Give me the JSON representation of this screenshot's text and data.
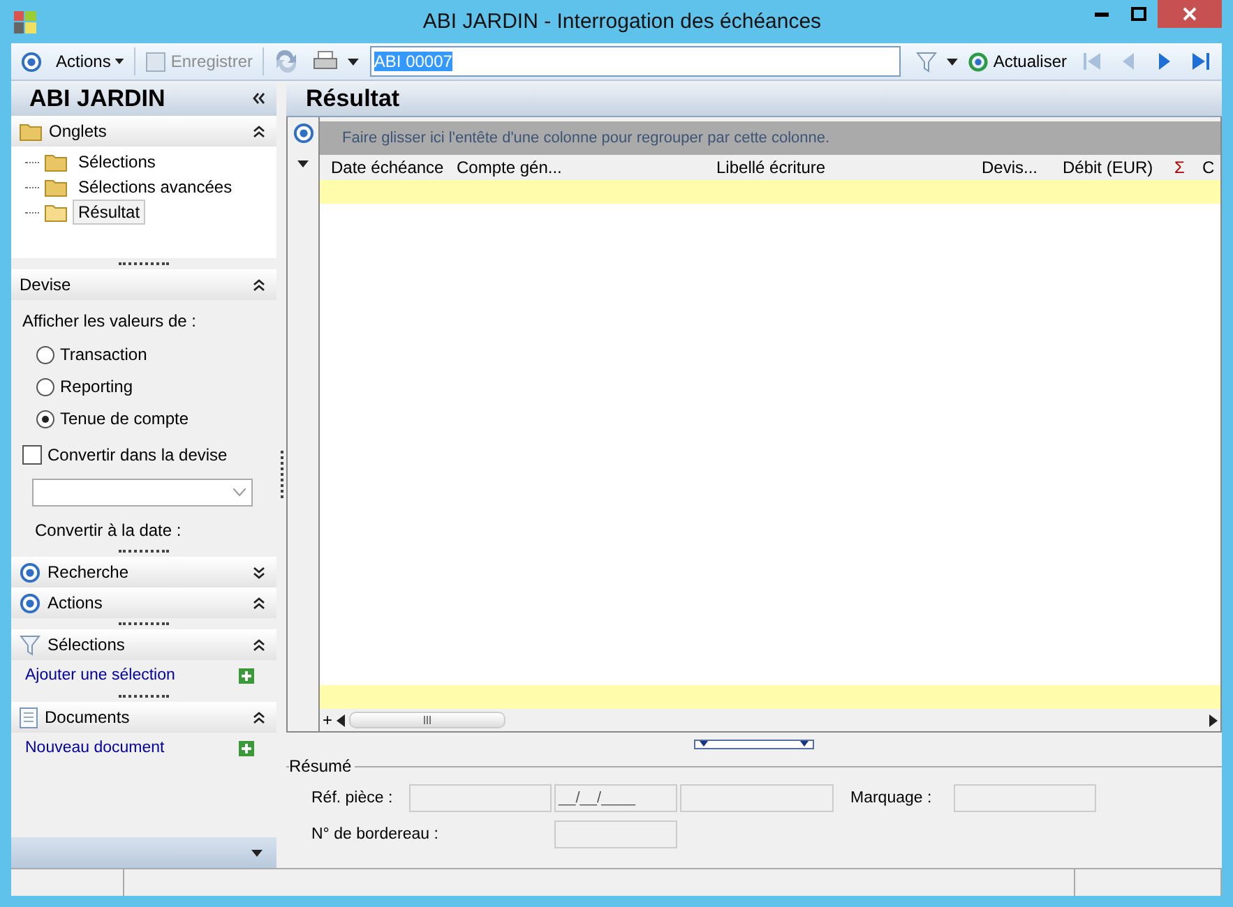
{
  "window": {
    "title": "ABI JARDIN -  Interrogation des échéances"
  },
  "toolbar": {
    "actions": "Actions",
    "save": {
      "label": "Enregistrer",
      "disabled": true
    },
    "search_value": "ABI 00007",
    "refresh": "Actualiser",
    "nav": [
      {
        "kind": "first",
        "disabled": true
      },
      {
        "kind": "prev",
        "disabled": true
      },
      {
        "kind": "next",
        "disabled": false
      },
      {
        "kind": "last",
        "disabled": false
      }
    ]
  },
  "sidebar": {
    "title": "ABI JARDIN",
    "panels": [
      {
        "kind": "tree",
        "title": "Onglets",
        "expanded": true,
        "children": [
          {
            "label": "Sélections",
            "selected": false
          },
          {
            "label": "Sélections avancées",
            "selected": false
          },
          {
            "label": "Résultat",
            "selected": true
          }
        ]
      },
      {
        "kind": "currency",
        "title": "Devise",
        "expanded": true,
        "prompt": "Afficher les valeurs de :",
        "options": [
          {
            "label": "Transaction",
            "selected": false
          },
          {
            "label": "Reporting",
            "selected": false
          },
          {
            "label": "Tenue de compte",
            "selected": true
          }
        ],
        "convert": {
          "label": "Convertir dans la devise",
          "checked": false
        },
        "date_label": "Convertir à la date :"
      },
      {
        "kind": "header",
        "title": "Recherche",
        "expanded": false
      },
      {
        "kind": "header",
        "title": "Actions",
        "expanded": true
      },
      {
        "kind": "link",
        "title": "Sélections",
        "expanded": true,
        "link": "Ajouter une sélection"
      },
      {
        "kind": "link",
        "title": "Documents",
        "expanded": true,
        "link": "Nouveau document"
      }
    ]
  },
  "result": {
    "title": "Résultat",
    "add_row_symbol": "+",
    "group_hint": "Faire glisser ici l'entête d'une colonne pour regrouper par cette colonne.",
    "columns": [
      {
        "kind": "text",
        "label": "Date échéance"
      },
      {
        "kind": "text",
        "label": "Compte gén..."
      },
      {
        "kind": "text",
        "label": "Libellé écriture"
      },
      {
        "kind": "text",
        "label": "Devis..."
      },
      {
        "kind": "text",
        "label": "Débit (EUR)"
      },
      {
        "kind": "sum",
        "label": "Σ"
      },
      {
        "kind": "text",
        "label": "C"
      }
    ]
  },
  "summary": {
    "title": "Résumé",
    "ref_label": "Réf. pièce :",
    "date_value": "__/__/____",
    "marking_label": "Marquage :",
    "slip_label": "N° de bordereau :"
  }
}
